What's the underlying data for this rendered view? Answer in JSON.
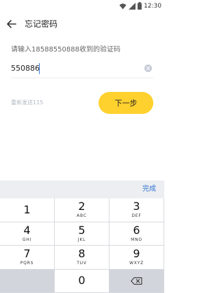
{
  "status_bar": {
    "time": "12:30",
    "icons": [
      "wifi-icon",
      "signal-icon",
      "battery-icon"
    ]
  },
  "header": {
    "title": "忘记密码",
    "back_icon": "arrow-left-icon"
  },
  "form": {
    "hint": "请输入18588550888收到的验证码",
    "code_value": "550886",
    "resend_label": "重新发送115",
    "next_label": "下一步",
    "clear_icon": "clear-icon"
  },
  "keyboard": {
    "done_label": "完成",
    "keys": [
      {
        "num": "1",
        "letters": ""
      },
      {
        "num": "2",
        "letters": "ABC"
      },
      {
        "num": "3",
        "letters": "DEF"
      },
      {
        "num": "4",
        "letters": "GHI"
      },
      {
        "num": "5",
        "letters": "JKL"
      },
      {
        "num": "6",
        "letters": "MNO"
      },
      {
        "num": "7",
        "letters": "PQRS"
      },
      {
        "num": "8",
        "letters": "TUV"
      },
      {
        "num": "9",
        "letters": "WXYZ"
      },
      {
        "num": "0",
        "letters": ""
      }
    ],
    "backspace_icon": "backspace-icon"
  },
  "colors": {
    "accent": "#ffd12e",
    "link": "#3478d4",
    "muted": "#b2b8c2"
  }
}
